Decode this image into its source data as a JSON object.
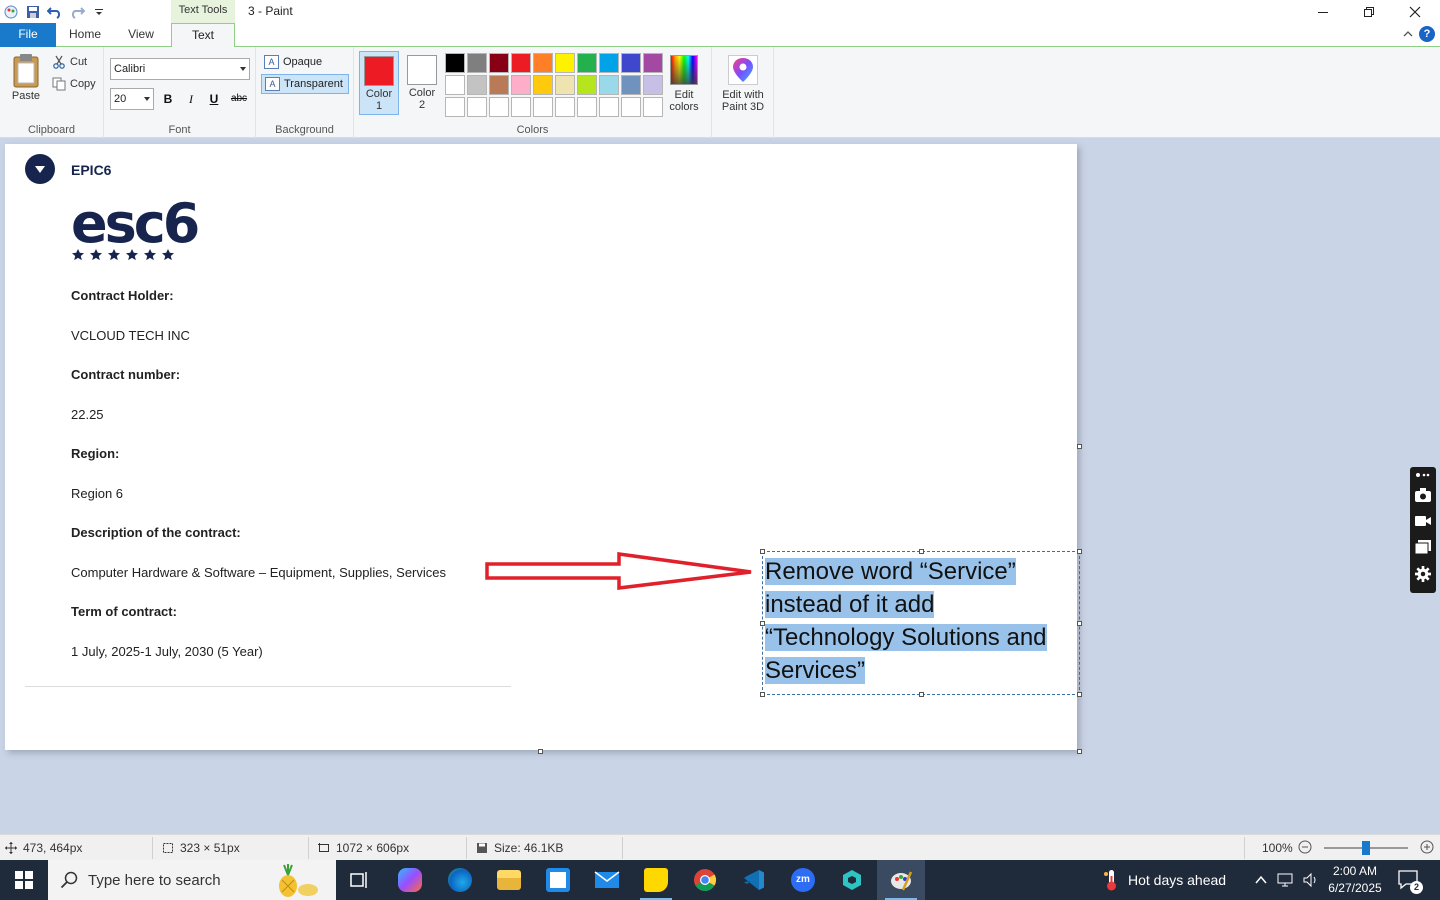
{
  "window": {
    "title": "3 - Paint",
    "context_tab_group": "Text Tools"
  },
  "tabs": {
    "file": "File",
    "home": "Home",
    "view": "View",
    "text": "Text"
  },
  "ribbon": {
    "clipboard": {
      "paste": "Paste",
      "cut": "Cut",
      "copy": "Copy",
      "label": "Clipboard"
    },
    "font": {
      "family": "Calibri",
      "size": "20",
      "bold": "B",
      "italic": "I",
      "underline": "U",
      "strike": "abc",
      "label": "Font"
    },
    "background": {
      "opaque": "Opaque",
      "transparent": "Transparent",
      "label": "Background"
    },
    "colors": {
      "color1_label": "Color",
      "color1_num": "1",
      "color2_label": "Color",
      "color2_num": "2",
      "color1_value": "#ed1c24",
      "color2_value": "#ffffff",
      "palette": [
        "#000000",
        "#7f7f7f",
        "#880015",
        "#ed1c24",
        "#ff7f27",
        "#fff200",
        "#22b14c",
        "#00a2e8",
        "#3f48cc",
        "#a349a4",
        "#ffffff",
        "#c3c3c3",
        "#b97a57",
        "#ffaec9",
        "#ffc90e",
        "#efe4b0",
        "#b5e61d",
        "#99d9ea",
        "#7092be",
        "#c8bfe7",
        "#ffffff",
        "#ffffff",
        "#ffffff",
        "#ffffff",
        "#ffffff",
        "#ffffff",
        "#ffffff",
        "#ffffff",
        "#ffffff",
        "#ffffff"
      ],
      "edit_colors_1": "Edit",
      "edit_colors_2": "colors",
      "label": "Colors"
    },
    "paint3d": {
      "line1": "Edit with",
      "line2": "Paint 3D"
    }
  },
  "document": {
    "org_name": "EPIC6",
    "logo_text": "esc6",
    "fields": [
      {
        "label": "Contract Holder:",
        "value": "VCLOUD TECH INC"
      },
      {
        "label": "Contract number:",
        "value": "22.25"
      },
      {
        "label": "Region:",
        "value": "Region 6"
      },
      {
        "label": "Description of the contract:",
        "value": "Computer Hardware & Software – Equipment, Supplies, Services"
      },
      {
        "label": "Term of contract:",
        "value": "1 July, 2025-1 July, 2030 (5 Year)"
      }
    ],
    "annotation_lines": [
      "Remove word “Service”",
      "instead of it add",
      "“Technology Solutions and",
      "Services”"
    ],
    "arrow_color": "#e0202a"
  },
  "statusbar": {
    "cursor_pos": "473, 464px",
    "selection_size": "323 × 51px",
    "image_size": "1072 × 606px",
    "file_size": "Size: 46.1KB",
    "zoom": "100%"
  },
  "taskbar": {
    "search_placeholder": "Type here to search",
    "weather": "Hot days ahead",
    "time": "2:00 AM",
    "date": "6/27/2025",
    "notification_count": "2"
  }
}
